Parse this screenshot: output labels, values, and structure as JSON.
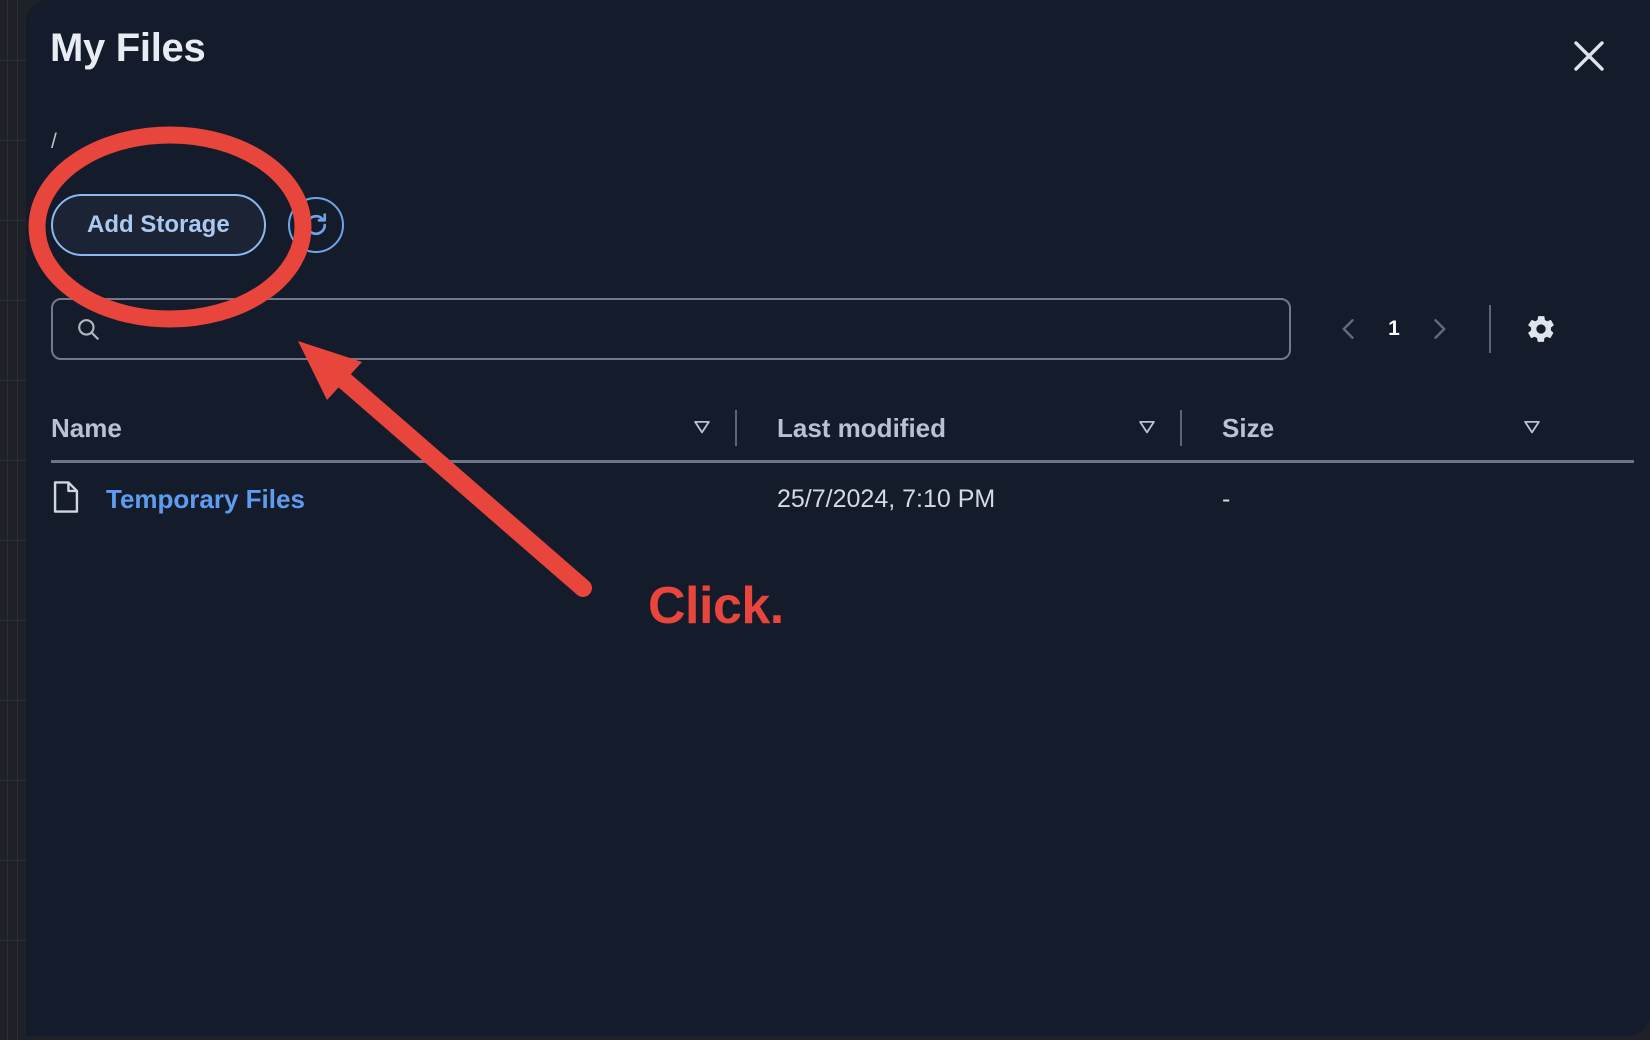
{
  "window": {
    "title": "My Files",
    "close_icon": "close-icon"
  },
  "breadcrumb": {
    "path": "/"
  },
  "toolbar": {
    "add_storage_label": "Add Storage",
    "refresh_icon": "refresh-icon"
  },
  "search": {
    "value": "",
    "placeholder": "",
    "icon": "search-icon"
  },
  "pagination": {
    "prev_icon": "chevron-left-icon",
    "page": "1",
    "next_icon": "chevron-right-icon",
    "settings_icon": "gear-icon"
  },
  "table": {
    "columns": [
      {
        "label": "Name",
        "sort_icon": "sort-descending-icon"
      },
      {
        "label": "Last modified",
        "sort_icon": "sort-descending-icon"
      },
      {
        "label": "Size",
        "sort_icon": "sort-descending-icon"
      }
    ],
    "rows": [
      {
        "icon": "file-icon",
        "name": "Temporary Files",
        "last_modified": "25/7/2024, 7:10 PM",
        "size": "-"
      }
    ]
  },
  "annotation": {
    "label": "Click.",
    "color": "#e8453c",
    "highlight_shape": "ellipse",
    "pointer_shape": "arrow"
  },
  "colors": {
    "modal_background": "#141b2a",
    "backdrop": "#1e2127",
    "accent_blue": "#5e9cf0",
    "button_border_blue": "#8cb8ef",
    "text_primary": "#e9edf3",
    "text_secondary": "#b8c2d0",
    "annotation_red": "#e8453c"
  }
}
